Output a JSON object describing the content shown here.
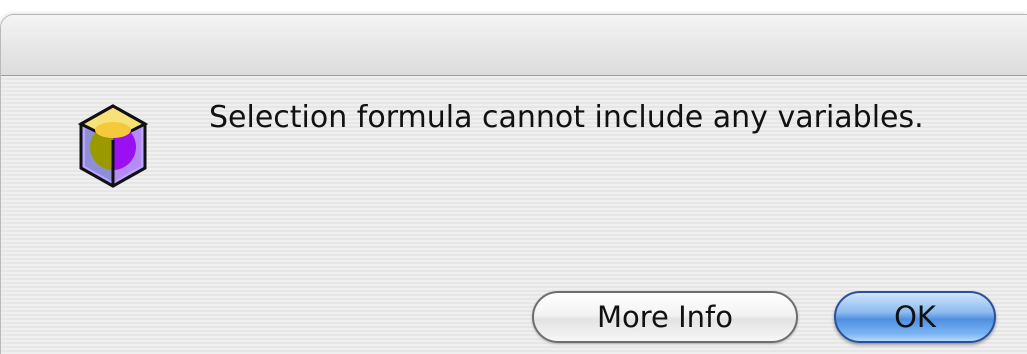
{
  "dialog": {
    "icon": "database-cube-icon",
    "message": "Selection formula cannot include any variables.",
    "buttons": {
      "more_info_label": "More Info",
      "ok_label": "OK"
    }
  },
  "colors": {
    "default_button": "#5b98e6",
    "body_background": "#ececec",
    "icon_purple": "#9a10f0",
    "icon_olive": "#9a9a00",
    "icon_yellow": "#f6c83c"
  }
}
